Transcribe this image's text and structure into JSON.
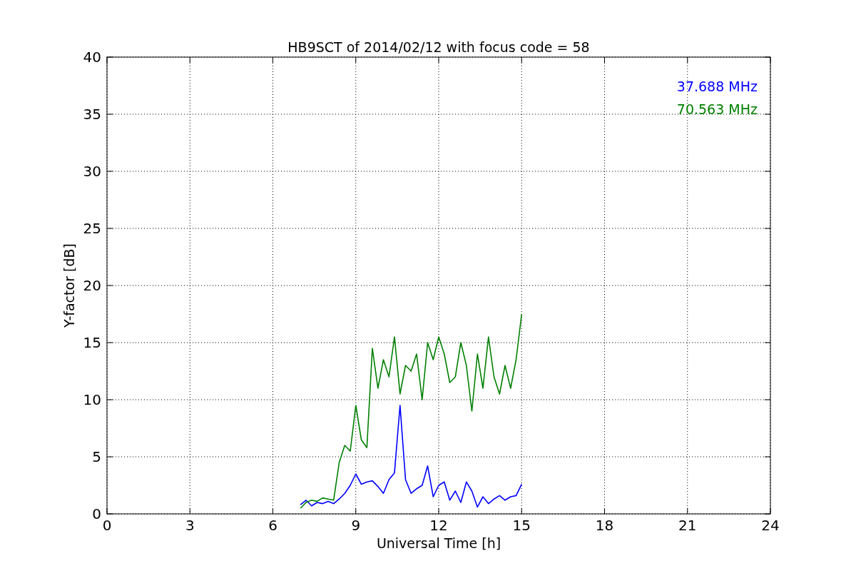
{
  "chart_data": {
    "type": "line",
    "title": "HB9SCT of 2014/02/12 with focus code = 58",
    "xlabel": "Universal Time [h]",
    "ylabel": "Y-factor [dB]",
    "x": [
      7.0,
      7.2,
      7.4,
      7.6,
      7.8,
      8.0,
      8.2,
      8.4,
      8.6,
      8.8,
      9.0,
      9.2,
      9.4,
      9.6,
      9.8,
      10.0,
      10.2,
      10.4,
      10.6,
      10.8,
      11.0,
      11.2,
      11.4,
      11.6,
      11.8,
      12.0,
      12.2,
      12.4,
      12.6,
      12.8,
      13.0,
      13.2,
      13.4,
      13.6,
      13.8,
      14.0,
      14.2,
      14.4,
      14.6,
      14.8,
      15.0
    ],
    "series": [
      {
        "name": "37.688 MHz",
        "color": "#0000ff",
        "values": [
          0.8,
          1.2,
          0.7,
          1.0,
          0.9,
          1.1,
          0.9,
          1.3,
          1.8,
          2.5,
          3.5,
          2.6,
          2.8,
          2.9,
          2.4,
          1.8,
          3.0,
          3.6,
          9.5,
          3.0,
          1.8,
          2.2,
          2.5,
          4.2,
          1.5,
          2.5,
          2.8,
          1.2,
          2.0,
          1.0,
          2.8,
          2.0,
          0.6,
          1.5,
          0.9,
          1.3,
          1.6,
          1.2,
          1.5,
          1.6,
          2.6
        ]
      },
      {
        "name": "70.563 MHz",
        "color": "#008000",
        "values": [
          0.5,
          1.0,
          1.2,
          1.1,
          1.4,
          1.3,
          1.2,
          4.5,
          6.0,
          5.5,
          9.5,
          6.5,
          5.8,
          14.5,
          11.0,
          13.5,
          12.0,
          15.5,
          10.5,
          13.0,
          12.5,
          14.0,
          10.0,
          15.0,
          13.5,
          15.5,
          14.0,
          11.5,
          12.0,
          15.0,
          13.0,
          9.0,
          14.0,
          11.0,
          15.5,
          12.0,
          10.5,
          13.0,
          11.0,
          13.5,
          17.5
        ]
      }
    ],
    "grid": true,
    "xlim": [
      0,
      24
    ],
    "ylim": [
      0,
      40
    ],
    "xticks": [
      0,
      3,
      6,
      9,
      12,
      15,
      18,
      21,
      24
    ],
    "yticks": [
      0,
      5,
      10,
      15,
      20,
      25,
      30,
      35,
      40
    ]
  }
}
